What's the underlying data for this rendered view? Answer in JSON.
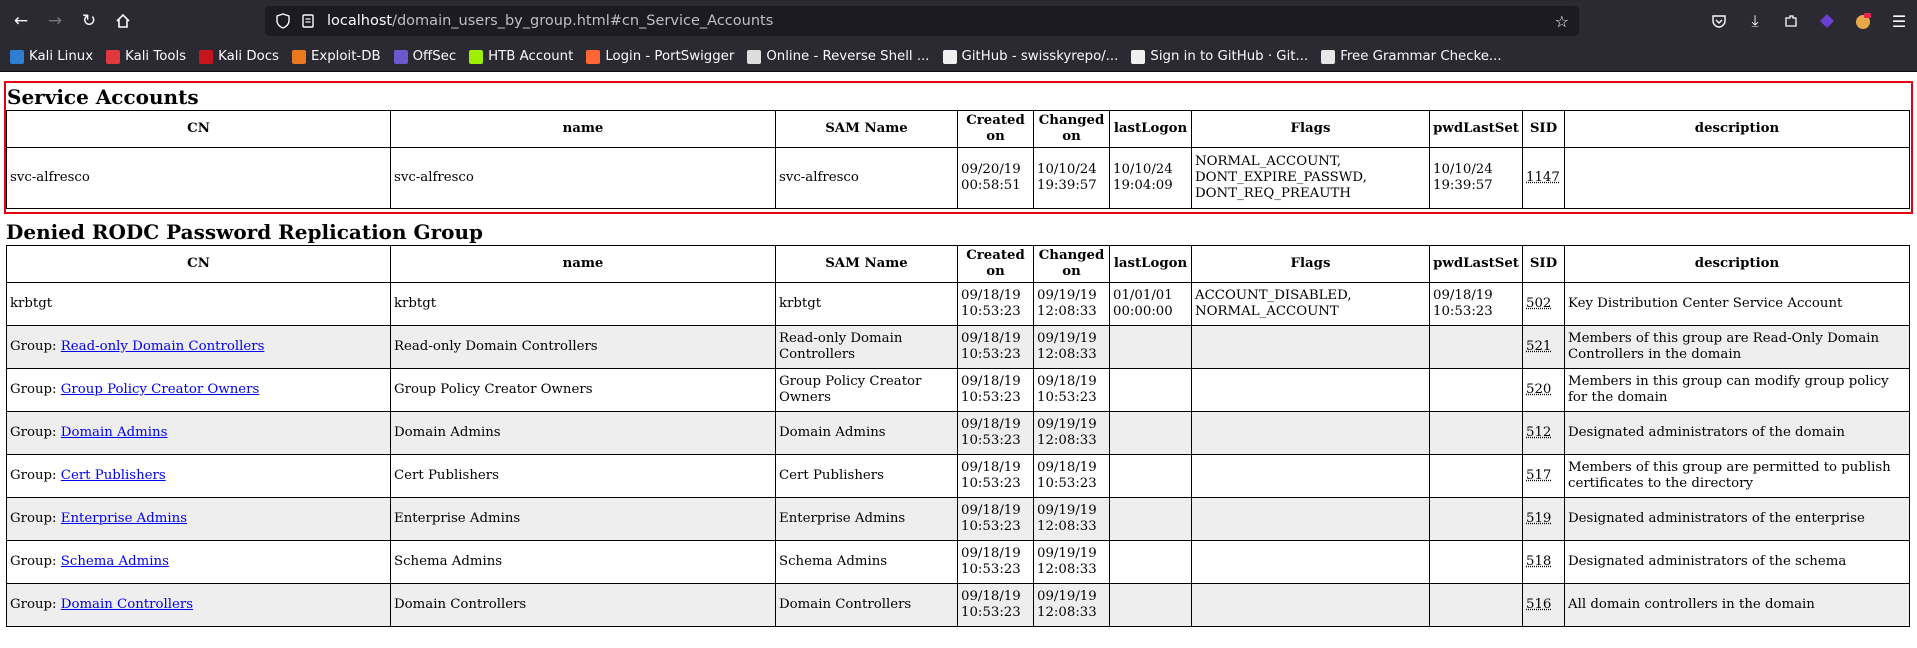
{
  "browser": {
    "url_host": "localhost",
    "url_path": "/domain_users_by_group.html#cn_Service_Accounts",
    "bookmarks": [
      {
        "label": "Kali Linux",
        "color": "#2f7fd1"
      },
      {
        "label": "Kali Tools",
        "color": "#e0393e"
      },
      {
        "label": "Kali Docs",
        "color": "#c4161c"
      },
      {
        "label": "Exploit-DB",
        "color": "#e8791f"
      },
      {
        "label": "OffSec",
        "color": "#6a5acd"
      },
      {
        "label": "HTB Account",
        "color": "#9fef00"
      },
      {
        "label": "Login - PortSwigger",
        "color": "#ff6633"
      },
      {
        "label": "Online - Reverse Shell ...",
        "color": "#dddddd"
      },
      {
        "label": "GitHub - swisskyrepo/...",
        "color": "#f0f0f0"
      },
      {
        "label": "Sign in to GitHub · Git...",
        "color": "#f0f0f0"
      },
      {
        "label": "Free Grammar Checke...",
        "color": "#e6e6e6"
      }
    ]
  },
  "columns": [
    "CN",
    "name",
    "SAM Name",
    "Created on",
    "Changed on",
    "lastLogon",
    "Flags",
    "pwdLastSet",
    "SID",
    "description"
  ],
  "service_accounts": {
    "title": "Service Accounts",
    "rows": [
      {
        "cn_prefix": "",
        "cn": "svc-alfresco",
        "name": "svc-alfresco",
        "sam": "svc-alfresco",
        "created": "09/20/19 00:58:51",
        "changed": "10/10/24 19:39:57",
        "logon": "10/10/24 19:04:09",
        "flags": "NORMAL_ACCOUNT, DONT_EXPIRE_PASSWD, DONT_REQ_PREAUTH",
        "pwd": "10/10/24 19:39:57",
        "sid": "1147",
        "desc": ""
      }
    ]
  },
  "denied_rodc": {
    "title": "Denied RODC Password Replication Group",
    "rows": [
      {
        "cn_prefix": "",
        "cn": "krbtgt",
        "name": "krbtgt",
        "sam": "krbtgt",
        "created": "09/18/19 10:53:23",
        "changed": "09/19/19 12:08:33",
        "logon": "01/01/01 00:00:00",
        "flags": "ACCOUNT_DISABLED, NORMAL_ACCOUNT",
        "pwd": "09/18/19 10:53:23",
        "sid": "502",
        "desc": "Key Distribution Center Service Account"
      },
      {
        "cn_prefix": "Group: ",
        "cn": "Read-only Domain Controllers",
        "name": "Read-only Domain Controllers",
        "sam": "Read-only Domain Controllers",
        "created": "09/18/19 10:53:23",
        "changed": "09/19/19 12:08:33",
        "logon": "",
        "flags": "",
        "pwd": "",
        "sid": "521",
        "desc": "Members of this group are Read-Only Domain Controllers in the domain"
      },
      {
        "cn_prefix": "Group: ",
        "cn": "Group Policy Creator Owners",
        "name": "Group Policy Creator Owners",
        "sam": "Group Policy Creator Owners",
        "created": "09/18/19 10:53:23",
        "changed": "09/18/19 10:53:23",
        "logon": "",
        "flags": "",
        "pwd": "",
        "sid": "520",
        "desc": "Members in this group can modify group policy for the domain"
      },
      {
        "cn_prefix": "Group: ",
        "cn": "Domain Admins",
        "name": "Domain Admins",
        "sam": "Domain Admins",
        "created": "09/18/19 10:53:23",
        "changed": "09/19/19 12:08:33",
        "logon": "",
        "flags": "",
        "pwd": "",
        "sid": "512",
        "desc": "Designated administrators of the domain"
      },
      {
        "cn_prefix": "Group: ",
        "cn": "Cert Publishers",
        "name": "Cert Publishers",
        "sam": "Cert Publishers",
        "created": "09/18/19 10:53:23",
        "changed": "09/18/19 10:53:23",
        "logon": "",
        "flags": "",
        "pwd": "",
        "sid": "517",
        "desc": "Members of this group are permitted to publish certificates to the directory"
      },
      {
        "cn_prefix": "Group: ",
        "cn": "Enterprise Admins",
        "name": "Enterprise Admins",
        "sam": "Enterprise Admins",
        "created": "09/18/19 10:53:23",
        "changed": "09/19/19 12:08:33",
        "logon": "",
        "flags": "",
        "pwd": "",
        "sid": "519",
        "desc": "Designated administrators of the enterprise"
      },
      {
        "cn_prefix": "Group: ",
        "cn": "Schema Admins",
        "name": "Schema Admins",
        "sam": "Schema Admins",
        "created": "09/18/19 10:53:23",
        "changed": "09/19/19 12:08:33",
        "logon": "",
        "flags": "",
        "pwd": "",
        "sid": "518",
        "desc": "Designated administrators of the schema"
      },
      {
        "cn_prefix": "Group: ",
        "cn": "Domain Controllers",
        "name": "Domain Controllers",
        "sam": "Domain Controllers",
        "created": "09/18/19 10:53:23",
        "changed": "09/19/19 12:08:33",
        "logon": "",
        "flags": "",
        "pwd": "",
        "sid": "516",
        "desc": "All domain controllers in the domain"
      }
    ]
  }
}
